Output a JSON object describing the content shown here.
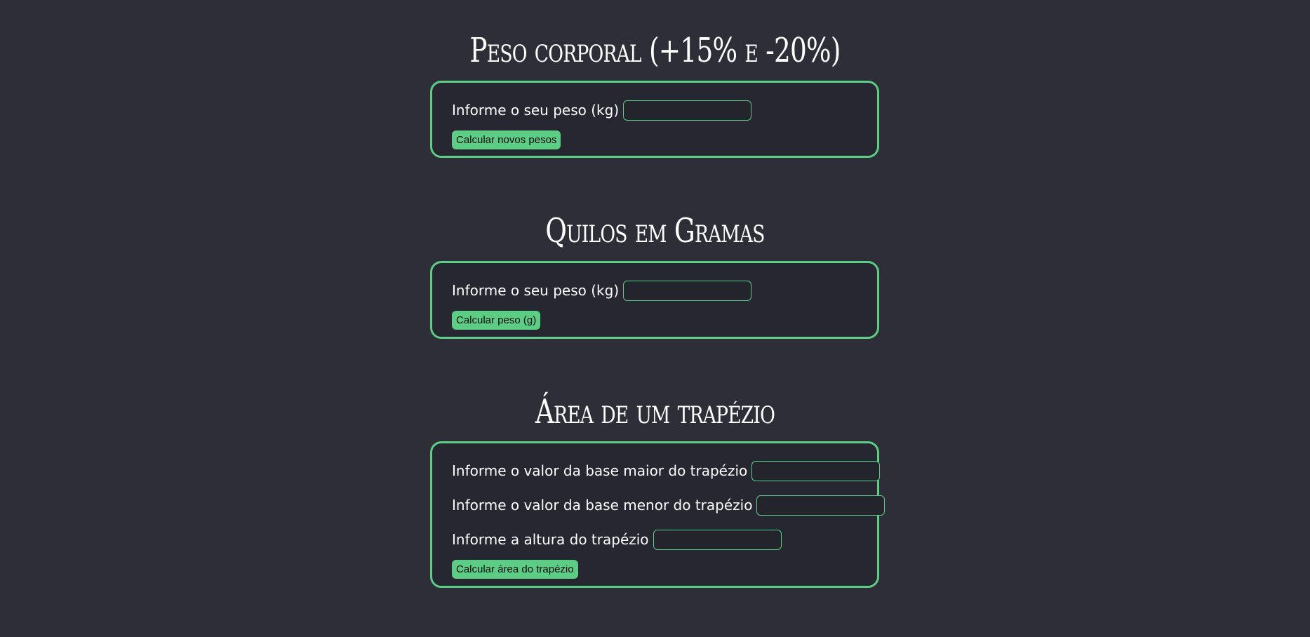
{
  "sections": [
    {
      "title": "Peso corporal (+15% e -20%)",
      "fields": [
        {
          "label": "Informe o seu peso (kg)",
          "value": ""
        }
      ],
      "button": "Calcular novos pesos"
    },
    {
      "title": "Quilos em Gramas",
      "fields": [
        {
          "label": "Informe o seu peso (kg)",
          "value": ""
        }
      ],
      "button": "Calcular peso (g)"
    },
    {
      "title": "Área de um trapézio",
      "fields": [
        {
          "label": "Informe o valor da base maior do trapézio",
          "value": ""
        },
        {
          "label": "Informe o valor da base menor do trapézio",
          "value": ""
        },
        {
          "label": "Informe a altura do trapézio",
          "value": ""
        }
      ],
      "button": "Calcular área do trapézio"
    }
  ],
  "colors": {
    "background": "#2d2e37",
    "card_background": "#262730",
    "accent": "#5ccd85"
  }
}
